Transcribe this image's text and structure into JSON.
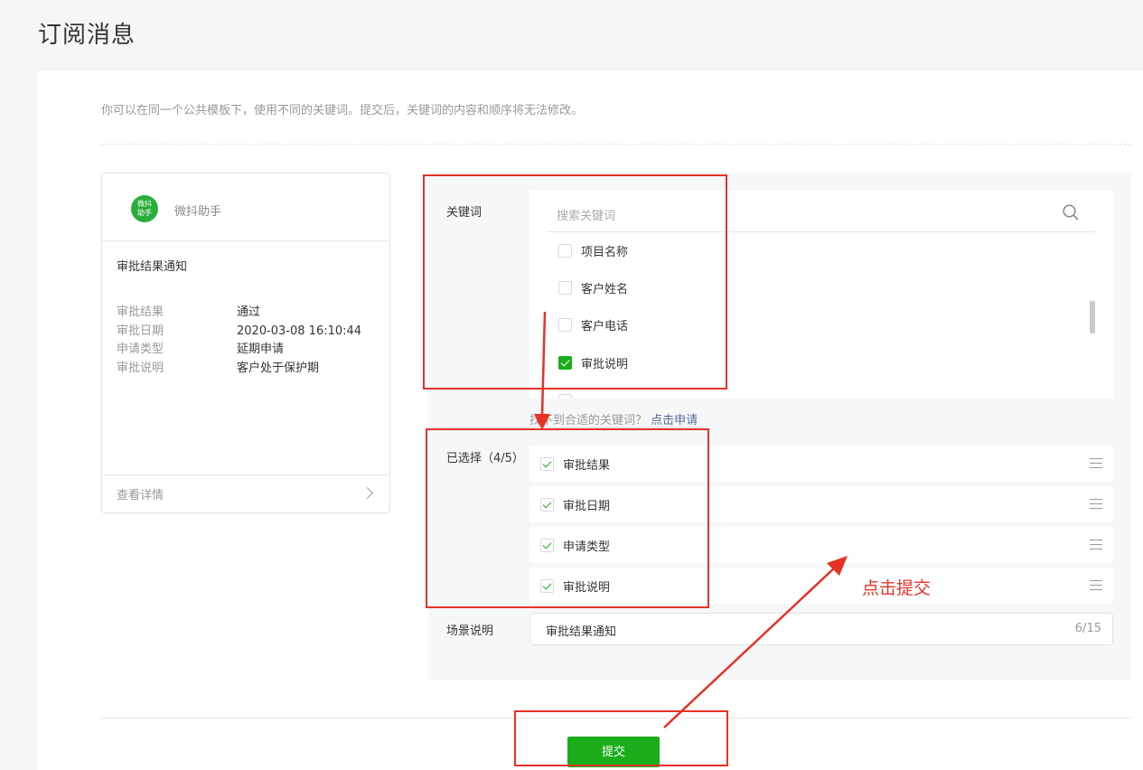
{
  "page": {
    "title": "订阅消息",
    "notice": "你可以在同一个公共模板下，使用不同的关键词。提交后，关键词的内容和顺序将无法修改。"
  },
  "preview": {
    "avatar_lines": [
      "微抖",
      "助手"
    ],
    "account_name": "微抖助手",
    "title": "审批结果通知",
    "rows": [
      {
        "key": "审批结果",
        "value": "通过"
      },
      {
        "key": "审批日期",
        "value": "2020-03-08 16:10:44"
      },
      {
        "key": "申请类型",
        "value": "延期申请"
      },
      {
        "key": "审批说明",
        "value": "客户处于保护期"
      }
    ],
    "detail_link": "查看详情"
  },
  "keywords": {
    "label": "关键词",
    "search_placeholder": "搜索关键词",
    "items": [
      {
        "label": "项目名称",
        "checked": false
      },
      {
        "label": "客户姓名",
        "checked": false
      },
      {
        "label": "客户电话",
        "checked": false
      },
      {
        "label": "审批说明",
        "checked": true
      }
    ],
    "hint_text": "找不到合适的关键词？",
    "hint_link": "点击申请"
  },
  "selected": {
    "label": "已选择（4/5）",
    "items": [
      "审批结果",
      "审批日期",
      "申请类型",
      "审批说明"
    ]
  },
  "scene": {
    "label": "场景说明",
    "value": "审批结果通知",
    "count": "6/15"
  },
  "submit_label": "提交",
  "annotation": {
    "text": "点击提交",
    "color": "#e63227"
  },
  "colors": {
    "brand_green": "#1aad19",
    "link": "#576b95"
  }
}
